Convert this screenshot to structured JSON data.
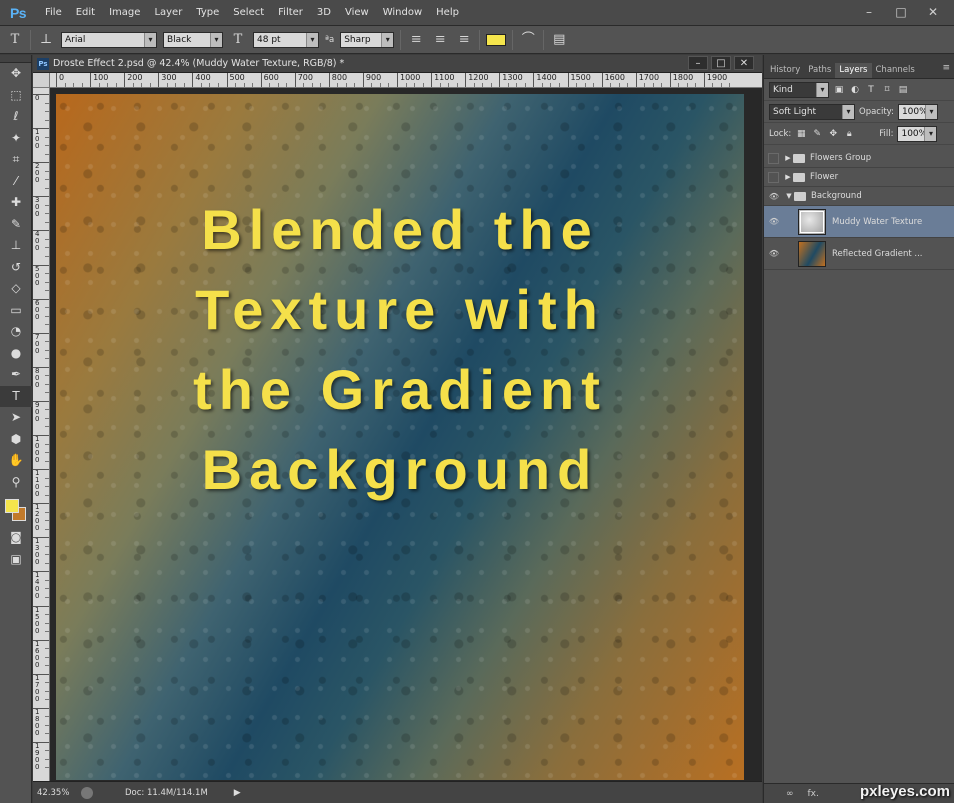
{
  "app": {
    "logo": "Ps",
    "menu": [
      "File",
      "Edit",
      "Image",
      "Layer",
      "Type",
      "Select",
      "Filter",
      "3D",
      "View",
      "Window",
      "Help"
    ],
    "window_controls": [
      "–",
      "□",
      "✕"
    ]
  },
  "options_bar": {
    "font_family": "Arial",
    "font_style": "Black",
    "font_size": "48 pt",
    "antialias_label": "ªa",
    "antialias": "Sharp",
    "text_color": "#f5e54c"
  },
  "tools": {
    "foreground_color": "#f5e54c",
    "background_color": "#c27a2a",
    "items": [
      "move-icon",
      "marquee-icon",
      "lasso-icon",
      "quick-select-icon",
      "crop-icon",
      "eyedropper-icon",
      "spot-heal-icon",
      "brush-icon",
      "clone-stamp-icon",
      "history-brush-icon",
      "eraser-icon",
      "gradient-icon",
      "blur-icon",
      "dodge-icon",
      "pen-icon",
      "type-icon",
      "path-select-icon",
      "shape-icon",
      "hand-icon",
      "zoom-icon"
    ]
  },
  "document": {
    "title": "Droste Effect 2.psd @ 42.4% (Muddy Water Texture, RGB/8) *",
    "ruler_marks": [
      "0",
      "100",
      "200",
      "300",
      "400",
      "500",
      "600",
      "700",
      "800",
      "900",
      "1000",
      "1100",
      "1200",
      "1300",
      "1400",
      "1500",
      "1600",
      "1700",
      "1800",
      "1900"
    ],
    "ruler_marks_left": [
      "0",
      "100",
      "200",
      "300",
      "400",
      "500",
      "600",
      "700",
      "800",
      "900",
      "1000",
      "1100",
      "1200",
      "1300",
      "1400",
      "1500",
      "1600",
      "1700",
      "1800",
      "1900"
    ],
    "canvas_text": [
      "Blended the",
      "Texture with",
      "the Gradient",
      "Background"
    ],
    "canvas_text_color": "#f5e04a",
    "zoom": "42.35%",
    "doc_info": "Doc: 11.4M/114.1M"
  },
  "panels": {
    "tabs": [
      "History",
      "Paths",
      "Layers",
      "Channels"
    ],
    "active_tab": "Layers",
    "filter_kind": "Kind",
    "blend_mode": "Soft Light",
    "opacity_label": "Opacity:",
    "opacity": "100%",
    "lock_label": "Lock:",
    "fill_label": "Fill:",
    "fill": "100%",
    "layers": [
      {
        "name": "Flowers Group",
        "type": "group",
        "visible": false,
        "expanded": false
      },
      {
        "name": "Flower",
        "type": "group",
        "visible": false,
        "expanded": false
      },
      {
        "name": "Background",
        "type": "group",
        "visible": true,
        "expanded": true
      },
      {
        "name": "Muddy Water Texture",
        "type": "layer",
        "visible": true,
        "selected": true
      },
      {
        "name": "Reflected Gradient ...",
        "type": "layer",
        "visible": true,
        "selected": false
      }
    ],
    "bottom_icons": [
      "∞",
      "fx."
    ]
  },
  "watermark": "pxleyes.com"
}
